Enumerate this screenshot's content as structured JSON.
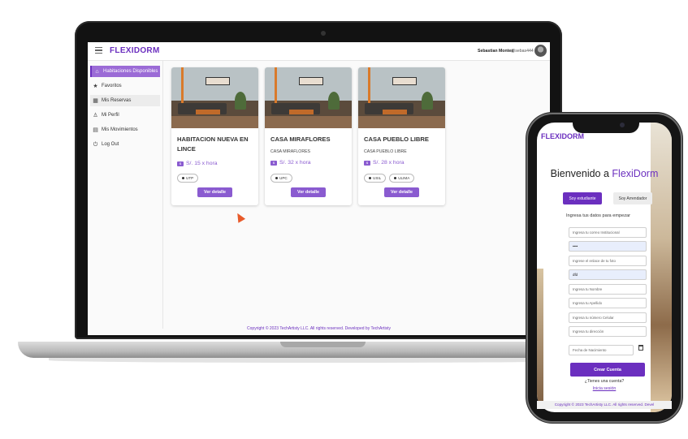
{
  "laptop": {
    "header": {
      "brand": "FLEXIDORM",
      "user_name": "Sebastian Montes",
      "user_handle": "@sebas444"
    },
    "sidebar": {
      "items": [
        {
          "label": "Habitaciones Disponibles",
          "icon": "home-icon",
          "glyph": "⌂"
        },
        {
          "label": "Favoritos",
          "icon": "star-icon",
          "glyph": "★"
        },
        {
          "label": "Mis Reservas",
          "icon": "calendar-icon",
          "glyph": "▦"
        },
        {
          "label": "Mi Perfil",
          "icon": "person-icon",
          "glyph": "♙"
        },
        {
          "label": "Mis Movimientos",
          "icon": "wallet-icon",
          "glyph": "▤"
        },
        {
          "label": "Log Out",
          "icon": "power-icon",
          "glyph": "⏻"
        }
      ]
    },
    "cards": [
      {
        "title": "HABITACION NUEVA EN LINCE",
        "subtitle": "",
        "price": "S/. 15 x hora",
        "chips": [
          "UTP"
        ],
        "button": "Ver detalle"
      },
      {
        "title": "CASA MIRAFLORES",
        "subtitle": "CASA MIRAFLORES",
        "price": "S/. 32 x hora",
        "chips": [
          "UPC"
        ],
        "button": "Ver detalle"
      },
      {
        "title": "CASA PUEBLO LIBRE",
        "subtitle": "CASA PUEBLO LIBRE",
        "price": "S/. 28 x hora",
        "chips": [
          "USIL",
          "ULIMA"
        ],
        "button": "Ver detalle"
      }
    ],
    "footer": "Copyright © 2023 TechArtisty LLC. All rights reserved. Developed by TechArtisty"
  },
  "phone": {
    "brand": "FLEXIDORM",
    "welcome_prefix": "Bienvenido a ",
    "welcome_accent": "FlexiDorm",
    "tabs": [
      "Soy estudiante",
      "Soy Arrendador"
    ],
    "hint": "Ingresa tus datos para empezar",
    "fields": [
      {
        "placeholder": "Ingresa tu correo Institucional",
        "value": ""
      },
      {
        "placeholder": "",
        "value": "••••"
      },
      {
        "placeholder": "Ingrese el enlace de tu foto",
        "value": ""
      },
      {
        "placeholder": "",
        "value": "dfd"
      },
      {
        "placeholder": "Ingresa tu Nombre",
        "value": ""
      },
      {
        "placeholder": "Ingresa tu Apellido",
        "value": ""
      },
      {
        "placeholder": "Ingresa tu número Celular",
        "value": ""
      },
      {
        "placeholder": "Ingresa tu dirección",
        "value": ""
      }
    ],
    "date_placeholder": "Fecha de Nacimiento",
    "create_button": "Crear Cuenta",
    "account_question": "¿Tienes una cuenta?",
    "login_link": "Inicia sesión",
    "footer": "Copyright © 2023 TechArtisty LLC. All rights reserved. Devel"
  },
  "colors": {
    "accent": "#6b2fbf",
    "accent_light": "#8a5bd0"
  }
}
